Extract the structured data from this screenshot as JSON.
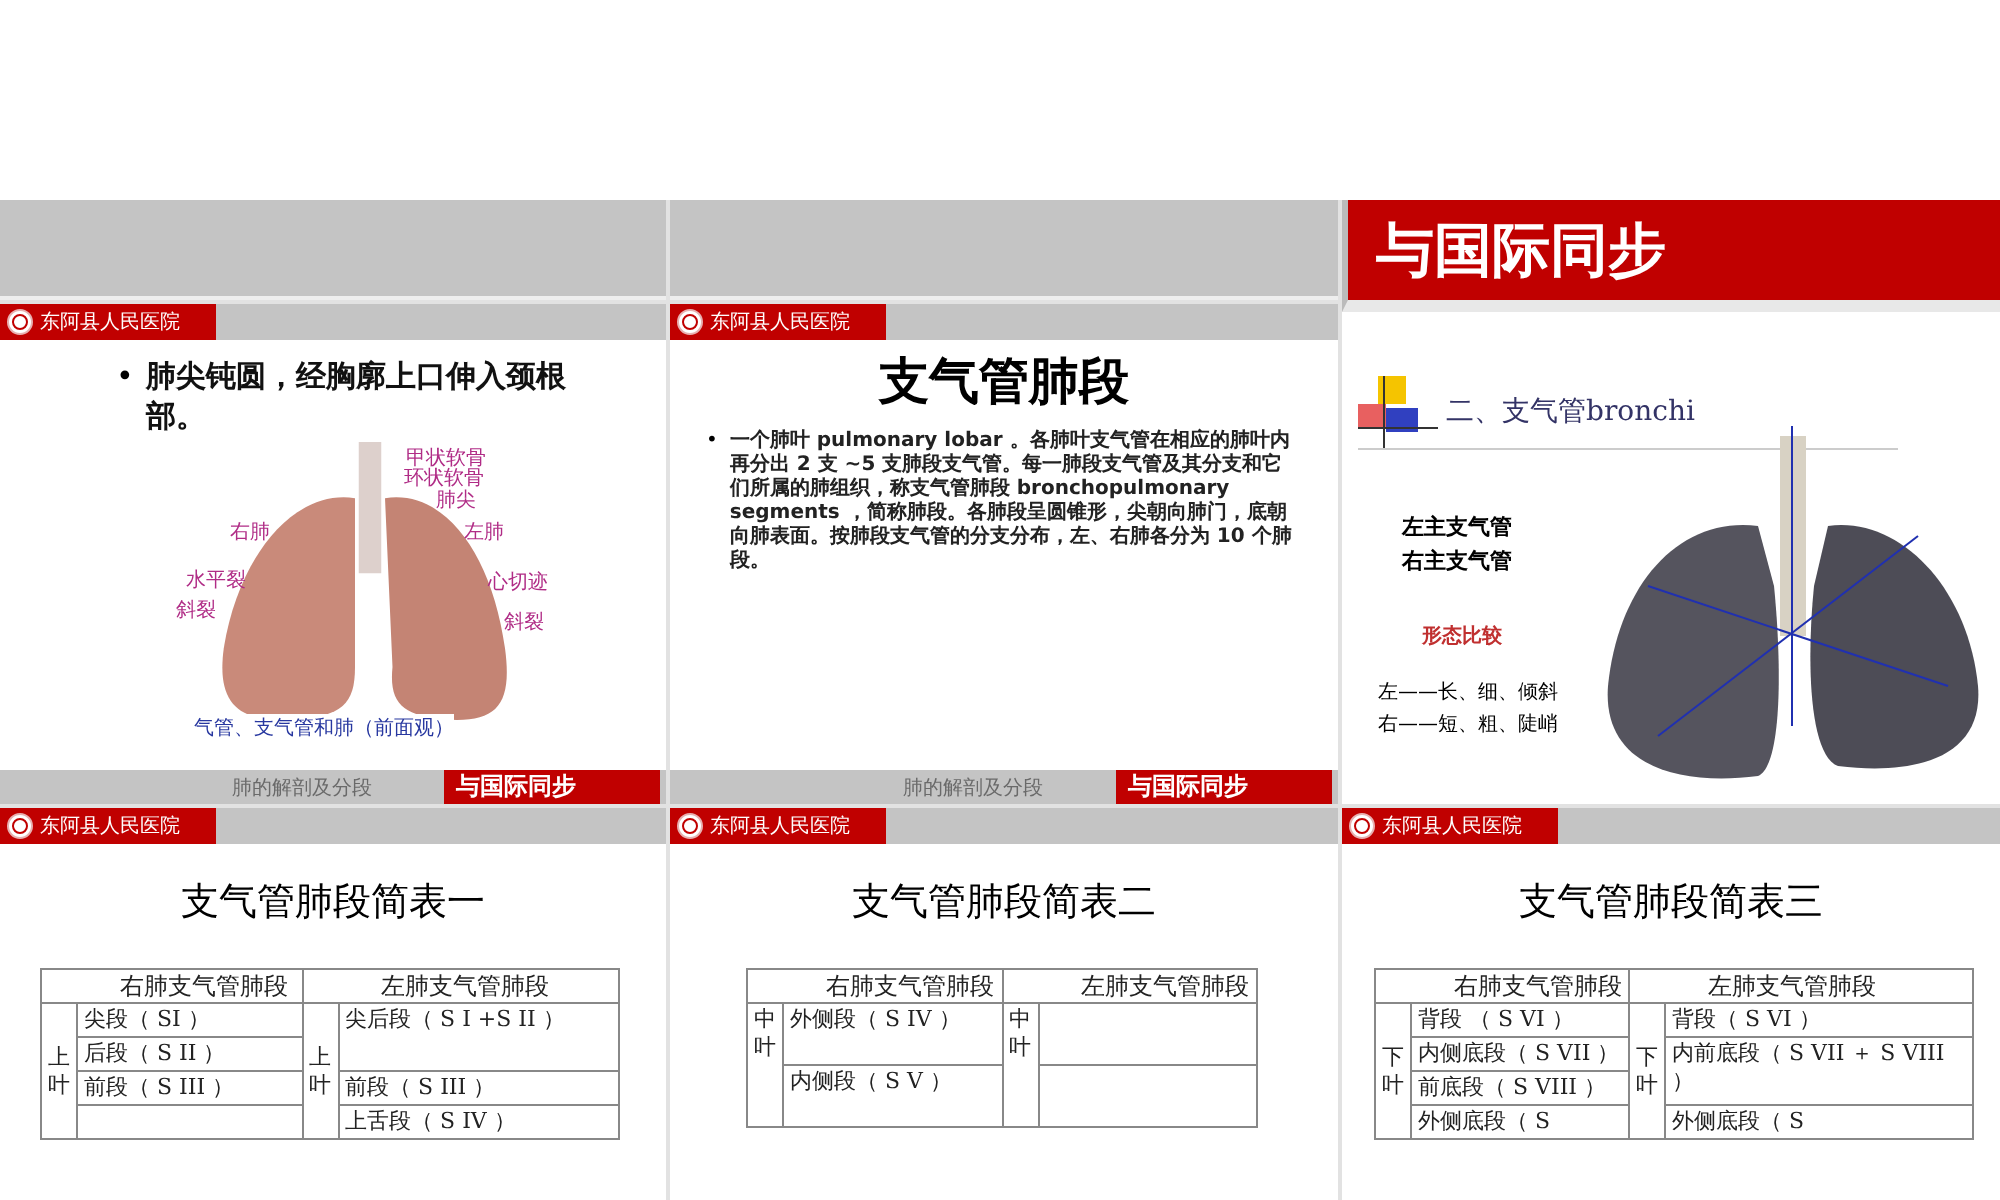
{
  "slides": [
    {
      "kind": "figure",
      "logo": "东阿县人民医院",
      "marker": "•",
      "bullet": "肺尖钝圆，经胸廓上口伸入颈根部。",
      "labels": [
        "甲状软骨",
        "环状软骨",
        "肺尖",
        "右肺",
        "左肺",
        "水平裂",
        "心切迹",
        "斜裂",
        "斜裂"
      ],
      "caption": "气管、支气管和肺（前面观）",
      "footer": {
        "note": "肺的解剖及分段",
        "badge": "与国际同步"
      }
    },
    {
      "kind": "text",
      "logo": "东阿县人民医院",
      "title": "支气管肺段",
      "marker": "•",
      "bullet": "一个肺叶 pulmonary lobar 。各肺叶支气管在相应的肺叶内再分出 2 支 ~5 支肺段支气管。每一肺段支气管及其分支和它们所属的肺组织，称支气管肺段 bronchopulmonary segments ，简称肺段。各肺段呈圆锥形，尖朝向肺门，底朝向肺表面。按肺段支气管的分支分布，左、右肺各分为 10 个肺段。",
      "footer": {
        "note": "肺的解剖及分段",
        "badge": "与国际同步"
      }
    },
    {
      "kind": "photo",
      "banner": "与国际同步",
      "heading": "二、支气管bronchi",
      "lines": [
        "左主支气管",
        "右主支气管"
      ],
      "subheading": "形态比较",
      "compare": [
        "左——长、细、倾斜",
        "右——短、粗、陡峭"
      ]
    },
    {
      "kind": "table",
      "logo": "东阿县人民医院",
      "title": "支气管肺段简表一",
      "header": [
        "右肺支气管肺段",
        "左肺支气管肺段"
      ],
      "rows": [
        [
          {
            "text": "上叶",
            "rowspan": 4
          },
          {
            "text": "尖段（ SI ）"
          },
          {
            "text": "上叶",
            "rowspan": 4
          },
          {
            "text": "尖后段（ S I +S II ）",
            "rowspan": 2
          }
        ],
        [
          {
            "text": "后段（ S II ）"
          }
        ],
        [
          {
            "text": "前段（ S III ）"
          },
          {
            "text": "前段（ S III ）"
          }
        ],
        [
          {},
          {
            "text": "上舌段（ S IV ）"
          }
        ]
      ]
    },
    {
      "kind": "table",
      "logo": "东阿县人民医院",
      "title": "支气管肺段简表二",
      "header": [
        "右肺支气管肺段",
        "左肺支气管肺段"
      ],
      "rows": [
        [
          {
            "text": "中叶",
            "rowspan": 2
          },
          {
            "text": "外侧段（ S IV ）"
          },
          {
            "text": "中叶",
            "rowspan": 2
          },
          {}
        ],
        [
          {
            "text": "内侧段（ S V ）"
          },
          {}
        ]
      ]
    },
    {
      "kind": "table",
      "logo": "东阿县人民医院",
      "title": "支气管肺段简表三",
      "header": [
        "右肺支气管肺段",
        "左肺支气管肺段"
      ],
      "rows": [
        [
          {
            "text": "下叶",
            "rowspan": 4
          },
          {
            "text": "背段 （ S VI ）"
          },
          {
            "text": "下叶",
            "rowspan": 4
          },
          {
            "text": "背段（ S VI ）"
          }
        ],
        [
          {
            "text": "内侧底段（ S VII ）"
          },
          {
            "text": "内前底段（ S VII ＋ S VIII ）",
            "rowspan": 2
          }
        ],
        [
          {
            "text": "前底段（ S VIII ）"
          }
        ],
        [
          {
            "text": "外侧底段（ S"
          },
          {
            "text": "外侧底段（ S"
          }
        ]
      ]
    }
  ]
}
